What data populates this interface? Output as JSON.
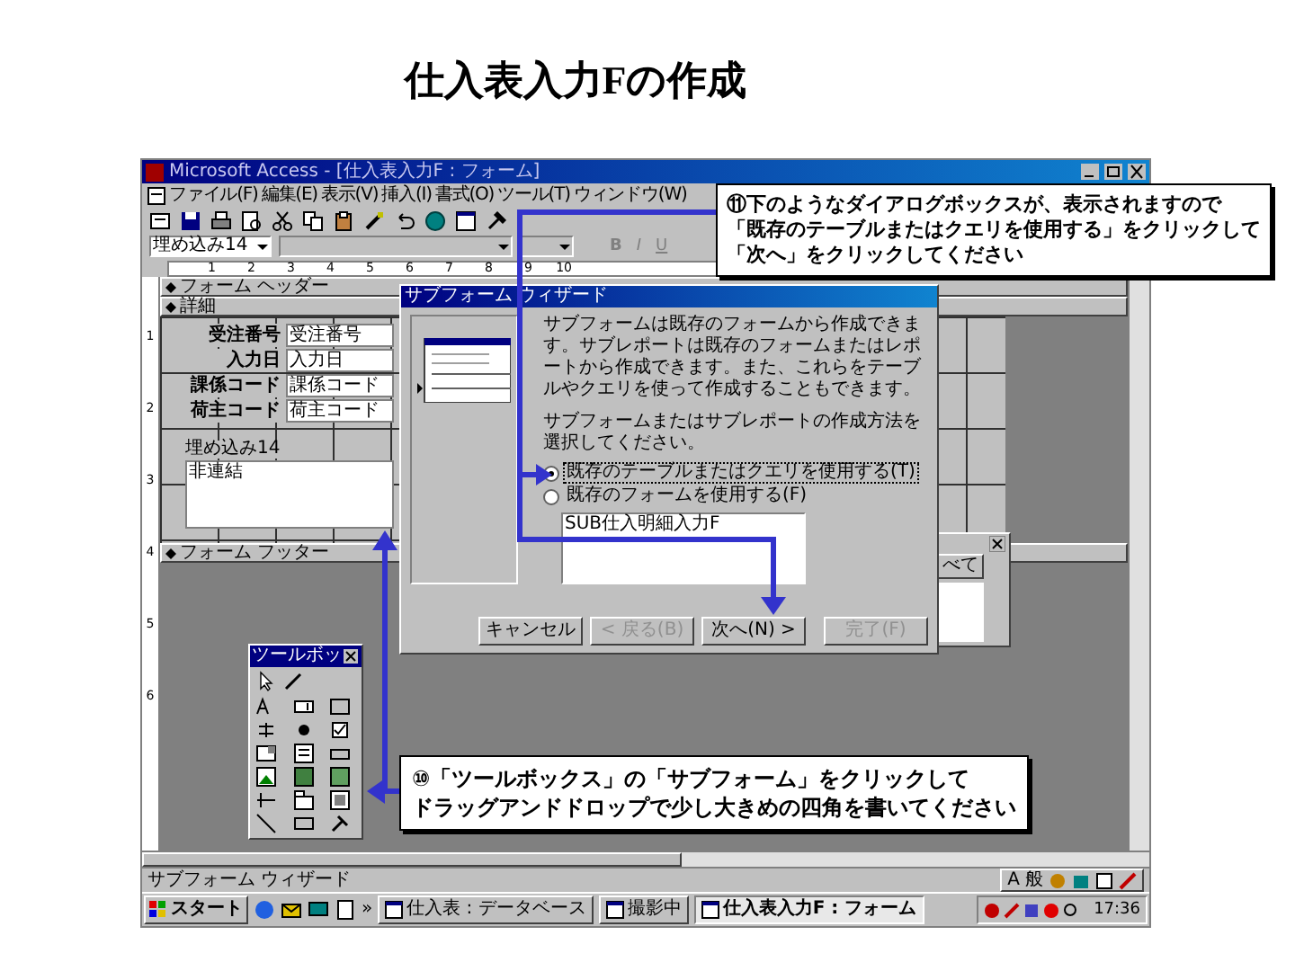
{
  "slide_title": "仕入表入力Fの作成",
  "window": {
    "title": "Microsoft Access - [仕入表入力F : フォーム]"
  },
  "menu": [
    "ファイル(F)",
    "編集(E)",
    "表示(V)",
    "挿入(I)",
    "書式(O)",
    "ツール(T)",
    "ウィンドウ(W)"
  ],
  "format_toolbar": {
    "object_dropdown": "埋め込み14",
    "bold": "B",
    "italic": "I",
    "underline": "U"
  },
  "horizontal_ruler": [
    "1",
    "2",
    "3",
    "4",
    "5",
    "6",
    "7",
    "8",
    "9",
    "10"
  ],
  "vertical_ruler": [
    "1",
    "2",
    "3",
    "4",
    "5",
    "6"
  ],
  "sections": {
    "header": "フォーム ヘッダー",
    "detail": "詳細",
    "footer": "フォーム フッター"
  },
  "fields": [
    {
      "label": "受注番号",
      "value": "受注番号"
    },
    {
      "label": "入力日",
      "value": "入力日"
    },
    {
      "label": "課係コード",
      "value": "課係コード"
    },
    {
      "label": "荷主コード",
      "value": "荷主コード"
    }
  ],
  "subform": {
    "label": "埋め込み14",
    "content": "非連結"
  },
  "property_sheet": {
    "tab": "べて"
  },
  "dialog": {
    "title": "サブフォーム ウィザード",
    "description": "サブフォームは既存のフォームから作成できます。サブレポートは既存のフォームまたはレポートから作成できます。また、これらをテーブルやクエリを使って作成することもできます。",
    "prompt": "サブフォームまたはサブレポートの作成方法を選択してください。",
    "options": [
      {
        "label": "既存のテーブルまたはクエリを使用する(T)",
        "selected": true
      },
      {
        "label": "既存のフォームを使用する(F)",
        "selected": false
      }
    ],
    "list_items": [
      "SUB仕入明細入力F"
    ],
    "buttons": [
      {
        "label": "キャンセル",
        "disabled": false
      },
      {
        "label": "< 戻る(B)",
        "disabled": true
      },
      {
        "label": "次へ(N) >",
        "disabled": false
      },
      {
        "label": "完了(F)",
        "disabled": true
      }
    ]
  },
  "toolbox": {
    "title": "ツールボッ"
  },
  "status_bar": {
    "text": "サブフォーム ウィザード",
    "ime_mode": "A",
    "ime_kanji": "般"
  },
  "taskbar": {
    "start": "スタート",
    "more": "»",
    "tasks": [
      {
        "label": "仕入表 : データベース",
        "selected": false
      },
      {
        "label": "撮影中",
        "selected": false
      },
      {
        "label": "仕入表入力F : フォーム",
        "selected": true
      }
    ],
    "clock": "17:36"
  },
  "callouts": [
    {
      "lines": [
        "⑪下のようなダイアログボックスが、表示されますので",
        "「既存のテーブルまたはクエリを使用する」をクリックして",
        "「次へ」をクリックしてください"
      ]
    },
    {
      "lines": [
        "⑩「ツールボックス」の「サブフォーム」をクリックして",
        "ドラッグアンドドロップで少し大きめの四角を書いてください"
      ]
    }
  ]
}
